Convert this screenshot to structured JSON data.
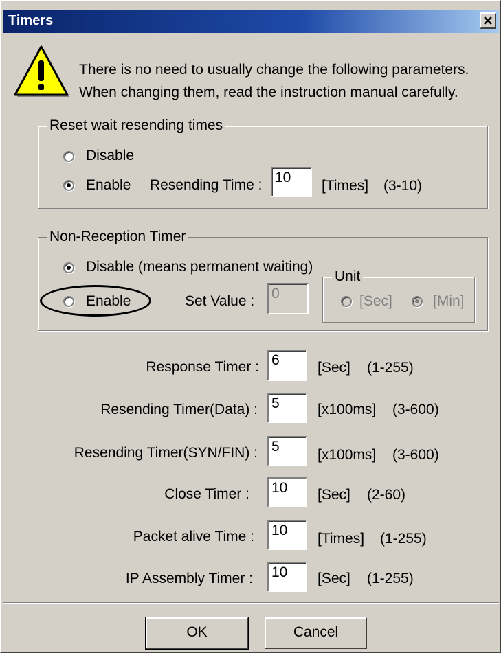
{
  "window": {
    "title": "Timers",
    "close_symbol": "×"
  },
  "warning": {
    "icon": "warning-icon",
    "line1": "There is no need to usually change the following parameters.",
    "line2": "When changing them, read the instruction manual carefully."
  },
  "reset_group": {
    "label": "Reset wait resending times",
    "disable_label": "Disable",
    "enable_label": "Enable",
    "selected": "enable",
    "resending_time_label": "Resending Time :",
    "resending_time_value": "10",
    "unit": "[Times]",
    "range": "(3-10)"
  },
  "nonreception_group": {
    "label": "Non-Reception Timer",
    "disable_label": "Disable (means permanent waiting)",
    "enable_label": "Enable",
    "selected": "disable",
    "set_value_label": "Set Value :",
    "set_value": "0",
    "unit_group_label": "Unit",
    "unit_sec": "[Sec]",
    "unit_min": "[Min]",
    "unit_selected": "min"
  },
  "timers": [
    {
      "label": "Response Timer :",
      "value": "6",
      "unit": "[Sec]",
      "range": "(1-255)"
    },
    {
      "label": "Resending Timer(Data) :",
      "value": "5",
      "unit": "[x100ms]",
      "range": "(3-600)"
    },
    {
      "label": "Resending Timer(SYN/FIN) :",
      "value": "5",
      "unit": "[x100ms]",
      "range": "(3-600)"
    },
    {
      "label": "Close Timer :",
      "value": "10",
      "unit": "[Sec]",
      "range": "(2-60)"
    },
    {
      "label": "Packet alive Time :",
      "value": "10",
      "unit": "[Times]",
      "range": "(1-255)"
    },
    {
      "label": "IP Assembly Timer :",
      "value": "10",
      "unit": "[Sec]",
      "range": "(1-255)"
    }
  ],
  "buttons": {
    "ok": "OK",
    "cancel": "Cancel"
  },
  "colors": {
    "titlebar": "#0a246a",
    "face": "#d4d0c8",
    "warning_yellow": "#ffff00"
  }
}
